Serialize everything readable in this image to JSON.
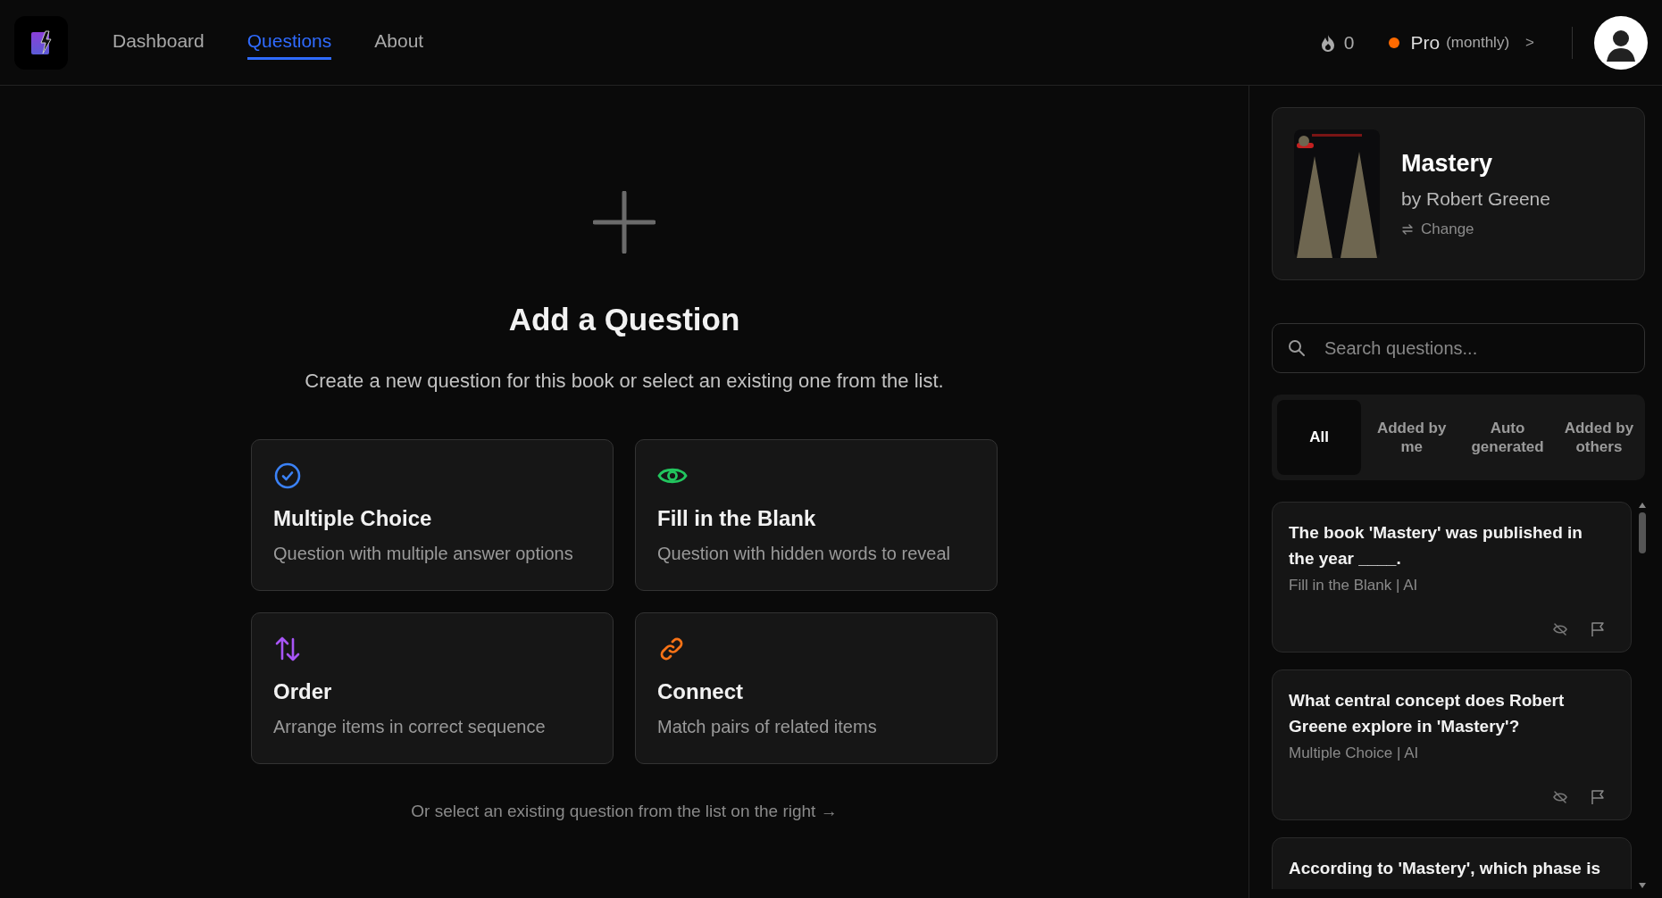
{
  "nav": {
    "links": [
      {
        "label": "Dashboard",
        "selected": false
      },
      {
        "label": "Questions",
        "selected": true
      },
      {
        "label": "About",
        "selected": false
      }
    ],
    "streak": "0",
    "plan": {
      "name": "Pro",
      "period": "(monthly)",
      "color": "#ff6a00",
      "chevron": ">"
    }
  },
  "main": {
    "title": "Add a Question",
    "subtitle": "Create a new question for this book or select an existing one from the list.",
    "types": [
      {
        "kind": "multiple_choice",
        "title": "Multiple Choice",
        "description": "Question with multiple answer options"
      },
      {
        "kind": "fill_blank",
        "title": "Fill in the Blank",
        "description": "Question with hidden words to reveal"
      },
      {
        "kind": "order",
        "title": "Order",
        "description": "Arrange items in correct sequence"
      },
      {
        "kind": "connect",
        "title": "Connect",
        "description": "Match pairs of related items"
      }
    ],
    "hint": "Or select an existing question from the list on the right →"
  },
  "sidebar": {
    "book": {
      "title": "Mastery",
      "author": "by Robert Greene",
      "change": "Change"
    },
    "search": {
      "placeholder": "Search questions..."
    },
    "filters": [
      {
        "label": "All",
        "selected": true
      },
      {
        "label": "Added by me",
        "selected": false
      },
      {
        "label": "Auto generated",
        "selected": false
      },
      {
        "label": "Added by others",
        "selected": false
      }
    ],
    "questions": [
      {
        "title": "The book 'Mastery' was published in the year ____.",
        "meta": "Fill in the Blank | AI"
      },
      {
        "title": "What central concept does Robert Greene explore in 'Mastery'?",
        "meta": "Multiple Choice | AI"
      },
      {
        "title": "According to 'Mastery', which phase is"
      }
    ]
  }
}
